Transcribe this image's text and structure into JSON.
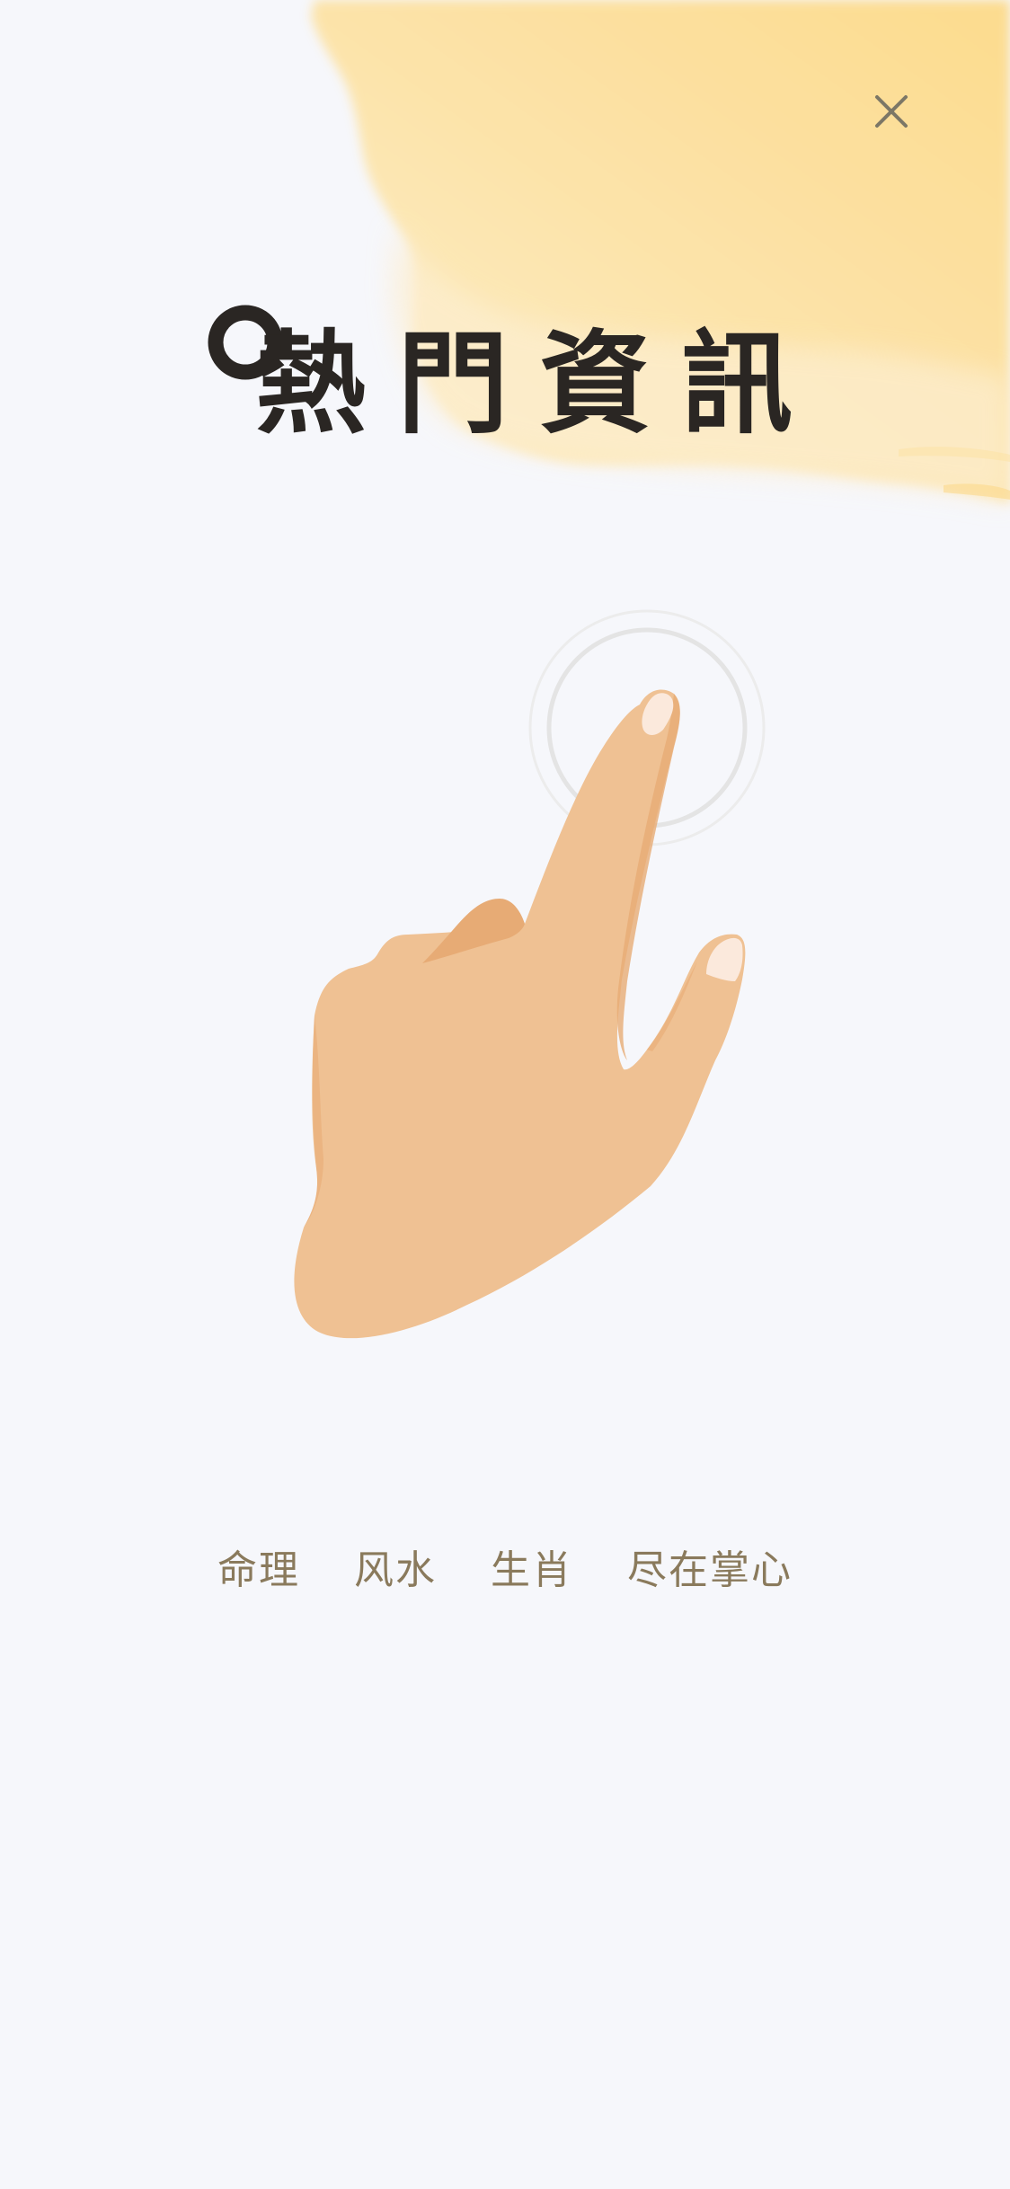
{
  "page": {
    "title": "熱門資訊",
    "tagline": "命理  风水  生肖  尽在掌心"
  },
  "close_button": {
    "icon": "close-icon"
  },
  "decor": {
    "ink_wash_color": "#fbd98a",
    "background_color": "#f6f7fb",
    "title_color": "#2a2623",
    "tagline_color": "#8a7a5c",
    "hand_color": "#efc193",
    "hand_shadow_color": "#e7ab75",
    "nail_color": "#fbe9dc",
    "tap_ring_color": "#e4e4e4",
    "icons": [
      "ink-wash-illustration",
      "title-ring-icon",
      "tapping-hand-illustration",
      "tap-ripple-icon"
    ]
  }
}
